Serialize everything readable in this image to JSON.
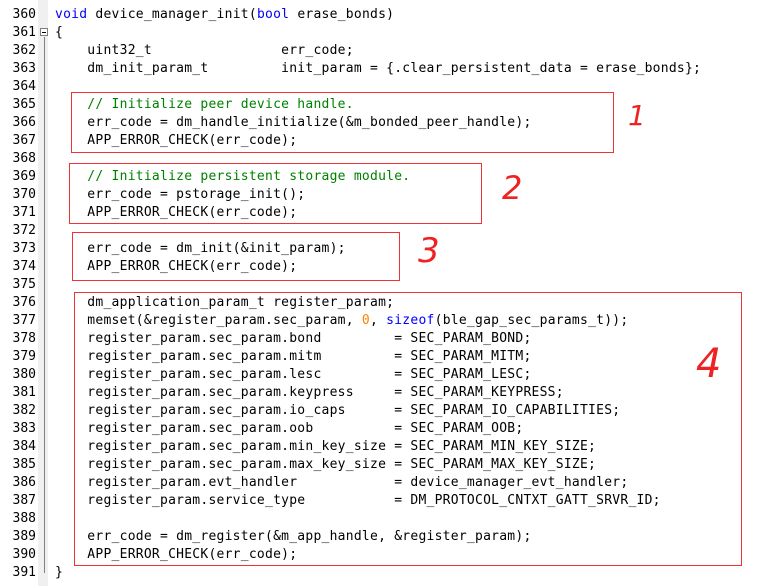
{
  "editor": {
    "lines": [
      {
        "n": "360",
        "parts": [
          {
            "t": "void",
            "c": "kw"
          },
          {
            "t": " device_manager_init(",
            "c": ""
          },
          {
            "t": "bool",
            "c": "kw"
          },
          {
            "t": " erase_bonds)",
            "c": ""
          }
        ]
      },
      {
        "n": "361",
        "parts": [
          {
            "t": "{",
            "c": ""
          }
        ]
      },
      {
        "n": "362",
        "parts": [
          {
            "t": "    uint32_t                err_code;",
            "c": ""
          }
        ]
      },
      {
        "n": "363",
        "parts": [
          {
            "t": "    dm_init_param_t         init_param = {.clear_persistent_data = erase_bonds};",
            "c": ""
          }
        ]
      },
      {
        "n": "364",
        "parts": []
      },
      {
        "n": "365",
        "parts": [
          {
            "t": "    // Initialize peer device handle.",
            "c": "cm"
          }
        ]
      },
      {
        "n": "366",
        "parts": [
          {
            "t": "    err_code = dm_handle_initialize(&m_bonded_peer_handle);",
            "c": ""
          }
        ]
      },
      {
        "n": "367",
        "parts": [
          {
            "t": "    APP_ERROR_CHECK(err_code);",
            "c": ""
          }
        ]
      },
      {
        "n": "368",
        "parts": []
      },
      {
        "n": "369",
        "parts": [
          {
            "t": "    // Initialize persistent storage module.",
            "c": "cm"
          }
        ]
      },
      {
        "n": "370",
        "parts": [
          {
            "t": "    err_code = pstorage_init();",
            "c": ""
          }
        ]
      },
      {
        "n": "371",
        "parts": [
          {
            "t": "    APP_ERROR_CHECK(err_code);",
            "c": ""
          }
        ]
      },
      {
        "n": "372",
        "parts": []
      },
      {
        "n": "373",
        "parts": [
          {
            "t": "    err_code = dm_init(&init_param);",
            "c": ""
          }
        ]
      },
      {
        "n": "374",
        "parts": [
          {
            "t": "    APP_ERROR_CHECK(err_code);",
            "c": ""
          }
        ]
      },
      {
        "n": "375",
        "parts": []
      },
      {
        "n": "376",
        "parts": [
          {
            "t": "    dm_application_param_t register_param;",
            "c": ""
          }
        ]
      },
      {
        "n": "377",
        "parts": [
          {
            "t": "    memset(&register_param.sec_param, ",
            "c": ""
          },
          {
            "t": "0",
            "c": "num"
          },
          {
            "t": ", ",
            "c": ""
          },
          {
            "t": "sizeof",
            "c": "kw"
          },
          {
            "t": "(ble_gap_sec_params_t));",
            "c": ""
          }
        ]
      },
      {
        "n": "378",
        "parts": [
          {
            "t": "    register_param.sec_param.bond         = SEC_PARAM_BOND;",
            "c": ""
          }
        ]
      },
      {
        "n": "379",
        "parts": [
          {
            "t": "    register_param.sec_param.mitm         = SEC_PARAM_MITM;",
            "c": ""
          }
        ]
      },
      {
        "n": "380",
        "parts": [
          {
            "t": "    register_param.sec_param.lesc         = SEC_PARAM_LESC;",
            "c": ""
          }
        ]
      },
      {
        "n": "381",
        "parts": [
          {
            "t": "    register_param.sec_param.keypress     = SEC_PARAM_KEYPRESS;",
            "c": ""
          }
        ]
      },
      {
        "n": "382",
        "parts": [
          {
            "t": "    register_param.sec_param.io_caps      = SEC_PARAM_IO_CAPABILITIES;",
            "c": ""
          }
        ]
      },
      {
        "n": "383",
        "parts": [
          {
            "t": "    register_param.sec_param.oob          = SEC_PARAM_OOB;",
            "c": ""
          }
        ]
      },
      {
        "n": "384",
        "parts": [
          {
            "t": "    register_param.sec_param.min_key_size = SEC_PARAM_MIN_KEY_SIZE;",
            "c": ""
          }
        ]
      },
      {
        "n": "385",
        "parts": [
          {
            "t": "    register_param.sec_param.max_key_size = SEC_PARAM_MAX_KEY_SIZE;",
            "c": ""
          }
        ]
      },
      {
        "n": "386",
        "parts": [
          {
            "t": "    register_param.evt_handler            = device_manager_evt_handler;",
            "c": ""
          }
        ]
      },
      {
        "n": "387",
        "parts": [
          {
            "t": "    register_param.service_type           = DM_PROTOCOL_CNTXT_GATT_SRVR_ID;",
            "c": ""
          }
        ]
      },
      {
        "n": "388",
        "parts": []
      },
      {
        "n": "389",
        "parts": [
          {
            "t": "    err_code = dm_register(&m_app_handle, &register_param);",
            "c": ""
          }
        ]
      },
      {
        "n": "390",
        "parts": [
          {
            "t": "    APP_ERROR_CHECK(err_code);",
            "c": ""
          }
        ]
      },
      {
        "n": "391",
        "parts": [
          {
            "t": "}",
            "c": ""
          }
        ]
      }
    ]
  },
  "annotations": {
    "mark_1": "1",
    "mark_2": "2",
    "mark_3": "3",
    "mark_4": "4"
  },
  "colors": {
    "keyword": "#0000ff",
    "comment": "#008000",
    "number": "#ff8000",
    "annotation": "#ee3333"
  },
  "icons": {
    "fold": "fold-minus-icon"
  }
}
